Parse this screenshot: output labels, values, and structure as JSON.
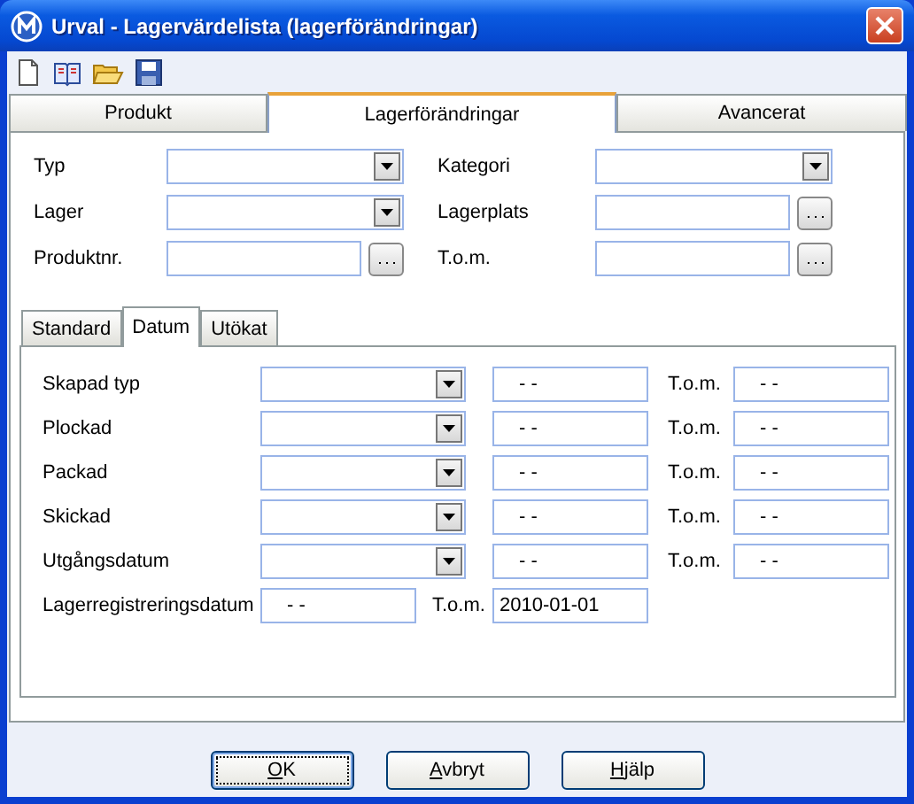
{
  "window": {
    "title": "Urval - Lagervärdelista (lagerförändringar)"
  },
  "toolbar": [
    {
      "kind": "new"
    },
    {
      "kind": "book"
    },
    {
      "kind": "open"
    },
    {
      "kind": "save"
    }
  ],
  "tabs": [
    {
      "label": "Produkt",
      "selected": false
    },
    {
      "label": "Lagerförändringar",
      "selected": true
    },
    {
      "label": "Avancerat",
      "selected": false
    }
  ],
  "filters": [
    {
      "label": "Typ",
      "kind": "combo"
    },
    {
      "label": "Kategori",
      "kind": "combo"
    },
    {
      "label": "Lager",
      "kind": "combo"
    },
    {
      "label": "Lagerplats",
      "kind": "browse"
    },
    {
      "label": "Produktnr.",
      "kind": "browse"
    },
    {
      "label": "T.o.m.",
      "kind": "browse"
    }
  ],
  "subtabs": [
    {
      "label": "Standard",
      "selected": false
    },
    {
      "label": "Datum",
      "selected": true
    },
    {
      "label": "Utökat",
      "selected": false
    }
  ],
  "date_rows": [
    {
      "label": "Skapad typ",
      "kind": "combo",
      "from": "- -",
      "to_label": "T.o.m.",
      "to": "- -"
    },
    {
      "label": "Plockad",
      "kind": "combo",
      "from": "- -",
      "to_label": "T.o.m.",
      "to": "- -"
    },
    {
      "label": "Packad",
      "kind": "combo",
      "from": "- -",
      "to_label": "T.o.m.",
      "to": "- -"
    },
    {
      "label": "Skickad",
      "kind": "combo",
      "from": "- -",
      "to_label": "T.o.m.",
      "to": "- -"
    },
    {
      "label": "Utgångsdatum",
      "kind": "combo",
      "from": "- -",
      "to_label": "T.o.m.",
      "to": "- -"
    },
    {
      "label": "Lagerregistreringsdatum",
      "kind": "plain",
      "from": "- -",
      "to_label": "T.o.m.",
      "to": "2010-01-01"
    }
  ],
  "buttons": [
    {
      "accel": "O",
      "rest": "K",
      "default": true
    },
    {
      "accel": "A",
      "rest": "vbryt",
      "default": false
    },
    {
      "accel": "H",
      "rest": "jälp",
      "default": false
    }
  ]
}
